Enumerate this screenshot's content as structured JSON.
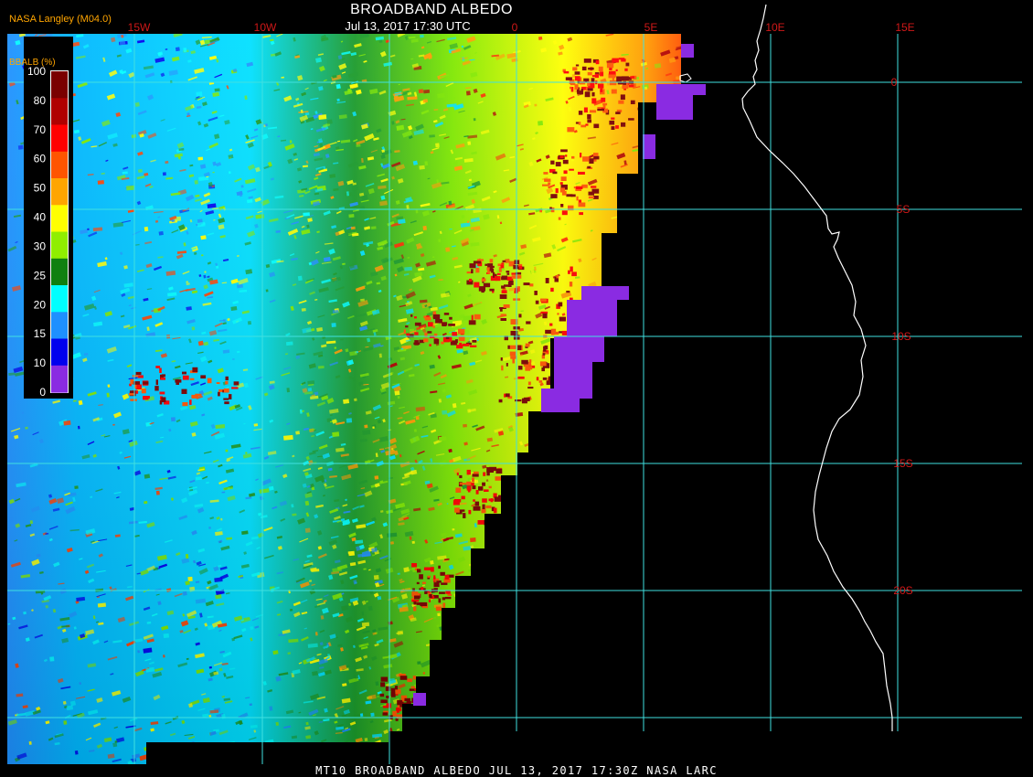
{
  "header": {
    "product_label": "NASA Langley (M04.0)",
    "title": "BROADBAND ALBEDO",
    "datetime": "Jul 13, 2017 17:30 UTC"
  },
  "grid": {
    "line_color": "#40e0e0",
    "label_color": "#d01818",
    "lon_labels": [
      "15W",
      "10W",
      "0",
      "5E",
      "10E",
      "15E"
    ],
    "lat_labels": [
      "0",
      "5S",
      "10S",
      "15S",
      "20S"
    ]
  },
  "legend": {
    "title": "BBALB (%)",
    "ticks": [
      "100",
      "80",
      "70",
      "60",
      "50",
      "40",
      "30",
      "25",
      "20",
      "15",
      "10",
      "0"
    ],
    "colors": [
      "#7a0000",
      "#b00000",
      "#ff0000",
      "#ff5500",
      "#ffa500",
      "#ffff00",
      "#90ee00",
      "#108010",
      "#00ffff",
      "#1e90ff",
      "#0000ee",
      "#8a2be2"
    ]
  },
  "footer": {
    "text": "MT10  BROADBAND ALBEDO   JUL 13, 2017 17:30Z   NASA LARC"
  }
}
